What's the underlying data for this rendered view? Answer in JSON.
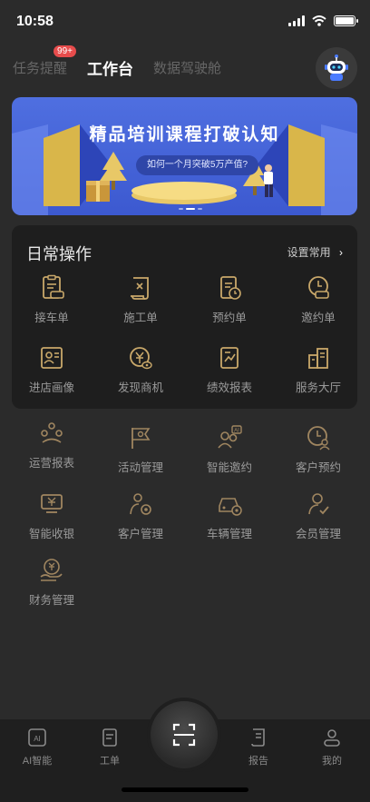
{
  "status": {
    "time": "10:58"
  },
  "tabs": [
    {
      "label": "任务提醒",
      "badge": "99+"
    },
    {
      "label": "工作台"
    },
    {
      "label": "数据驾驶舱"
    }
  ],
  "banner": {
    "title": "精品培训课程打破认知",
    "subtitle": "如何一个月突破5万产值?"
  },
  "daily": {
    "title": "日常操作",
    "setting": "设置常用",
    "items": [
      {
        "label": "接车单",
        "icon": "car-sheet-icon"
      },
      {
        "label": "施工单",
        "icon": "scroll-icon"
      },
      {
        "label": "预约单",
        "icon": "clock-clipboard-icon"
      },
      {
        "label": "邀约单",
        "icon": "car-clock-icon"
      },
      {
        "label": "进店画像",
        "icon": "id-card-icon"
      },
      {
        "label": "发现商机",
        "icon": "coin-eye-icon"
      },
      {
        "label": "绩效报表",
        "icon": "report-icon"
      },
      {
        "label": "服务大厅",
        "icon": "building-icon"
      }
    ]
  },
  "more": [
    {
      "label": "运营报表",
      "icon": "operation-icon"
    },
    {
      "label": "活动管理",
      "icon": "flag-icon"
    },
    {
      "label": "智能邀约",
      "icon": "ai-users-icon"
    },
    {
      "label": "客户预约",
      "icon": "clock-user-icon"
    },
    {
      "label": "智能收银",
      "icon": "cashier-icon"
    },
    {
      "label": "客户管理",
      "icon": "user-gear-icon"
    },
    {
      "label": "车辆管理",
      "icon": "car-gear-icon"
    },
    {
      "label": "会员管理",
      "icon": "member-icon"
    },
    {
      "label": "财务管理",
      "icon": "finance-icon"
    }
  ],
  "nav": [
    {
      "label": "AI智能",
      "icon": "ai-icon"
    },
    {
      "label": "工单",
      "icon": "work-order-icon"
    },
    {
      "label": "报告",
      "icon": "report-scroll-icon"
    },
    {
      "label": "我的",
      "icon": "profile-icon"
    }
  ],
  "colors": {
    "gold": "#c9a86a",
    "bg": "#2b2b2b",
    "card": "#1e1e1e",
    "banner": "#4f6fe0"
  }
}
